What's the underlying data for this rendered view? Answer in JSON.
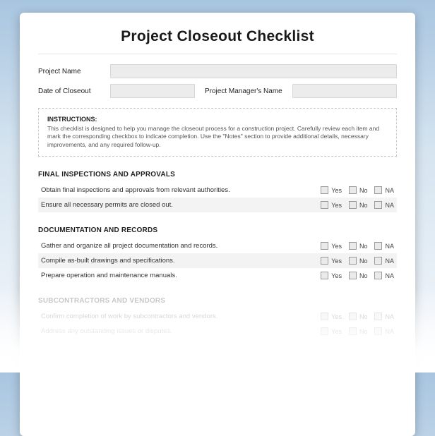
{
  "title": "Project Closeout Checklist",
  "fields": {
    "project_name_label": "Project Name",
    "project_name_value": "",
    "date_label": "Date of Closeout",
    "date_value": "",
    "manager_label": "Project Manager's Name",
    "manager_value": ""
  },
  "instructions": {
    "heading": "INSTRUCTIONS:",
    "body": "This checklist is designed to help you manage the closeout process for a construction project. Carefully review each item and mark the corresponding checkbox to indicate completion. Use the \"Notes\" section to provide additional details, necessary improvements, and any required follow-up."
  },
  "options": {
    "yes": "Yes",
    "no": "No",
    "na": "NA"
  },
  "sections": [
    {
      "title": "FINAL INSPECTIONS AND APPROVALS",
      "rows": [
        "Obtain final inspections and approvals from relevant authorities.",
        "Ensure all necessary permits are closed out."
      ]
    },
    {
      "title": "DOCUMENTATION AND RECORDS",
      "rows": [
        "Gather and organize all project documentation and records.",
        "Compile as-built drawings and specifications.",
        "Prepare operation and maintenance manuals."
      ]
    },
    {
      "title": "SUBCONTRACTORS AND VENDORS",
      "rows": [
        "Confirm completion of work by subcontractors and vendors.",
        "Address any outstanding issues or disputes."
      ]
    }
  ]
}
